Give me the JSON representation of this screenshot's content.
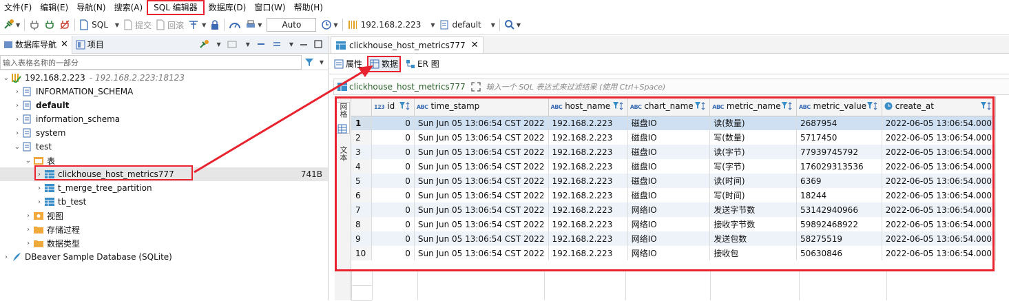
{
  "menu": [
    "文件(F)",
    "编辑(E)",
    "导航(N)",
    "搜索(A)",
    "SQL 编辑器",
    "数据库(D)",
    "窗口(W)",
    "帮助(H)"
  ],
  "toolbar": {
    "sql_label": "SQL",
    "commit_label": "提交",
    "rollback_label": "回滚",
    "auto_label": "Auto",
    "connection_label": "192.168.2.223",
    "schema_label": "default"
  },
  "left_panel": {
    "tab_navigator": "数据库导航",
    "tab_projects": "项目",
    "filter_placeholder": "输入表格名称的一部分",
    "tree": [
      {
        "label": "192.168.2.223",
        "sub": "- 192.168.2.223:18123"
      },
      {
        "label": "INFORMATION_SCHEMA"
      },
      {
        "label": "default"
      },
      {
        "label": "information_schema"
      },
      {
        "label": "system"
      },
      {
        "label": "test"
      },
      {
        "label": "表"
      },
      {
        "label": "clickhouse_host_metrics777",
        "size": "741B"
      },
      {
        "label": "t_merge_tree_partition"
      },
      {
        "label": "tb_test"
      },
      {
        "label": "视图"
      },
      {
        "label": "存储过程"
      },
      {
        "label": "数据类型"
      },
      {
        "label": "DBeaver Sample Database (SQLite)"
      }
    ]
  },
  "editor": {
    "tab_title": "clickhouse_host_metrics777",
    "subtabs": [
      "属性",
      "数据",
      "ER 图"
    ],
    "query_table": "clickhouse_host_metrics777",
    "query_placeholder": "输入一个 SQL 表达式来过滤结果 (使用 Ctrl+Space)",
    "side_tabs": [
      "网格",
      "文本"
    ],
    "columns": [
      {
        "name": "id",
        "type": "123"
      },
      {
        "name": "time_stamp",
        "type": "ABC"
      },
      {
        "name": "host_name",
        "type": "ABC"
      },
      {
        "name": "chart_name",
        "type": "ABC"
      },
      {
        "name": "metric_name",
        "type": "ABC"
      },
      {
        "name": "metric_value",
        "type": "ABC"
      },
      {
        "name": "create_at",
        "type": "clock"
      }
    ],
    "rows": [
      [
        "1",
        "0",
        "Sun Jun 05 13:06:54 CST 2022",
        "192.168.2.223",
        "磁盘IO",
        "读(数量)",
        "2687954",
        "2022-06-05 13:06:54.000"
      ],
      [
        "2",
        "0",
        "Sun Jun 05 13:06:54 CST 2022",
        "192.168.2.223",
        "磁盘IO",
        "写(数量)",
        "5717450",
        "2022-06-05 13:06:54.000"
      ],
      [
        "3",
        "0",
        "Sun Jun 05 13:06:54 CST 2022",
        "192.168.2.223",
        "磁盘IO",
        "读(字节)",
        "77939745792",
        "2022-06-05 13:06:54.000"
      ],
      [
        "4",
        "0",
        "Sun Jun 05 13:06:54 CST 2022",
        "192.168.2.223",
        "磁盘IO",
        "写(字节)",
        "176029313536",
        "2022-06-05 13:06:54.000"
      ],
      [
        "5",
        "0",
        "Sun Jun 05 13:06:54 CST 2022",
        "192.168.2.223",
        "磁盘IO",
        "读(时间)",
        "6369",
        "2022-06-05 13:06:54.000"
      ],
      [
        "6",
        "0",
        "Sun Jun 05 13:06:54 CST 2022",
        "192.168.2.223",
        "磁盘IO",
        "写(时间)",
        "18244",
        "2022-06-05 13:06:54.000"
      ],
      [
        "7",
        "0",
        "Sun Jun 05 13:06:54 CST 2022",
        "192.168.2.223",
        "网络IO",
        "发送字节数",
        "53142940966",
        "2022-06-05 13:06:54.000"
      ],
      [
        "8",
        "0",
        "Sun Jun 05 13:06:54 CST 2022",
        "192.168.2.223",
        "网络IO",
        "接收字节数",
        "59892468922",
        "2022-06-05 13:06:54.000"
      ],
      [
        "9",
        "0",
        "Sun Jun 05 13:06:54 CST 2022",
        "192.168.2.223",
        "网络IO",
        "发送包数",
        "58275519",
        "2022-06-05 13:06:54.000"
      ],
      [
        "10",
        "0",
        "Sun Jun 05 13:06:54 CST 2022",
        "192.168.2.223",
        "网络IO",
        "接收包",
        "50630846",
        "2022-06-05 13:06:54.000"
      ]
    ]
  },
  "colors": {
    "annotation": "#e8232f",
    "selected_row": "#cfe0f3",
    "alt_row": "#eef3fa"
  }
}
